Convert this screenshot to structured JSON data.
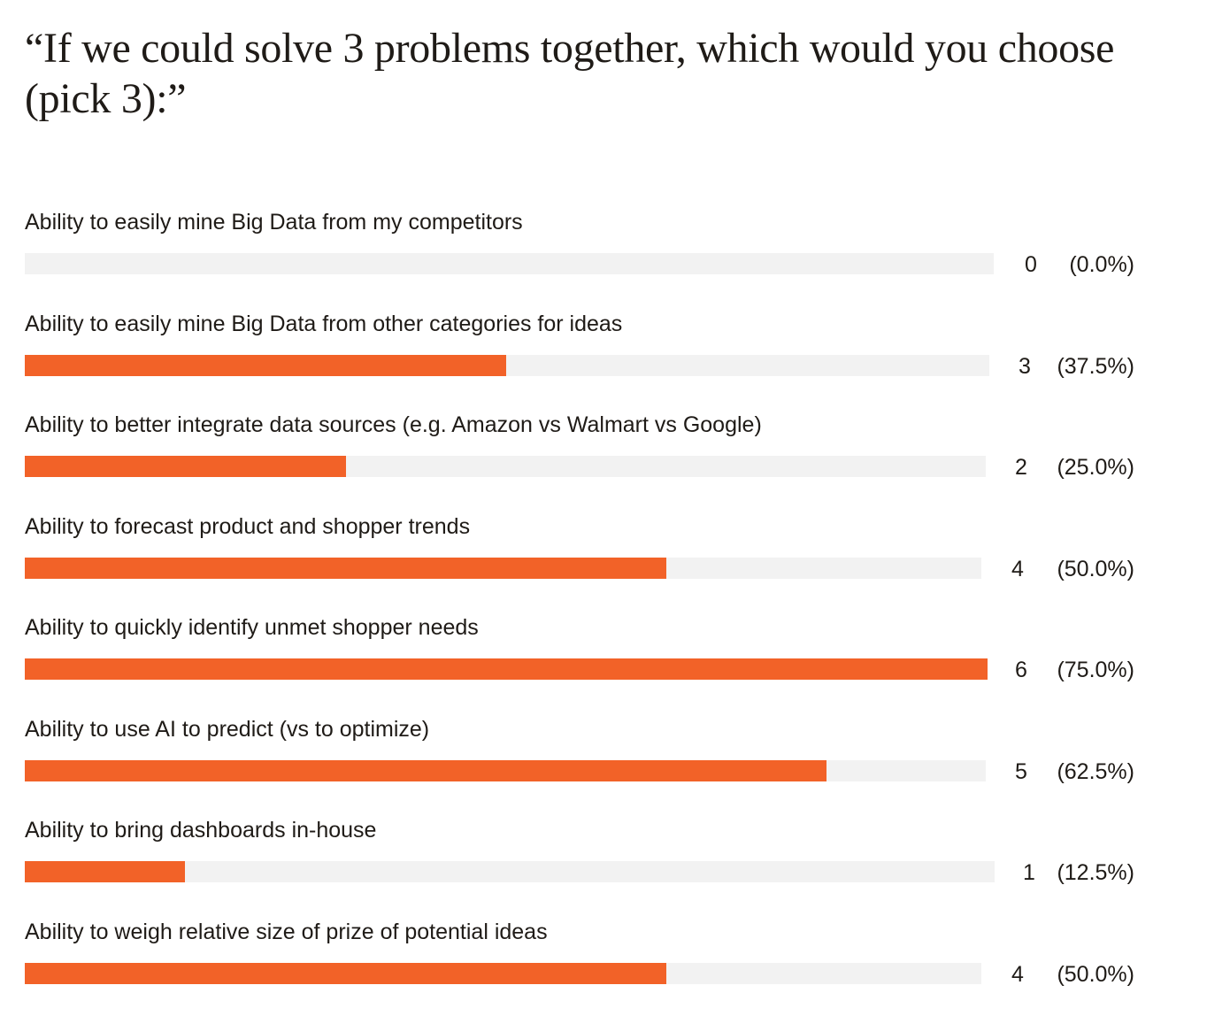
{
  "chart_data": {
    "type": "bar",
    "orientation": "horizontal",
    "title": "“If we could solve 3 problems together, which would you choose (pick 3):”",
    "categories": [
      "Ability to easily mine Big Data from my competitors",
      "Ability to easily mine Big Data from other categories for ideas",
      "Ability to better integrate data sources (e.g. Amazon vs Walmart vs Google)",
      "Ability to forecast product and shopper trends",
      "Ability to quickly identify unmet shopper needs",
      "Ability to use AI to predict (vs to optimize)",
      "Ability to bring dashboards in-house",
      "Ability to weigh relative size of prize of potential ideas"
    ],
    "values": [
      0,
      3,
      2,
      4,
      6,
      5,
      1,
      4
    ],
    "value_labels": [
      "0",
      "3",
      "2",
      "4",
      "6",
      "5",
      "1",
      "4"
    ],
    "percent_labels": [
      "(0.0%)",
      "(37.5%)",
      "(25.0%)",
      "(50.0%)",
      "(75.0%)",
      "(62.5%)",
      "(12.5%)",
      "(50.0%)"
    ],
    "percentages": [
      0.0,
      37.5,
      25.0,
      50.0,
      75.0,
      62.5,
      12.5,
      50.0
    ],
    "xlim": [
      0,
      100
    ],
    "grid": false,
    "legend": "none",
    "colors": {
      "bar": "#f26228",
      "track": "#f2f2f2",
      "text": "#1f1b17"
    }
  }
}
